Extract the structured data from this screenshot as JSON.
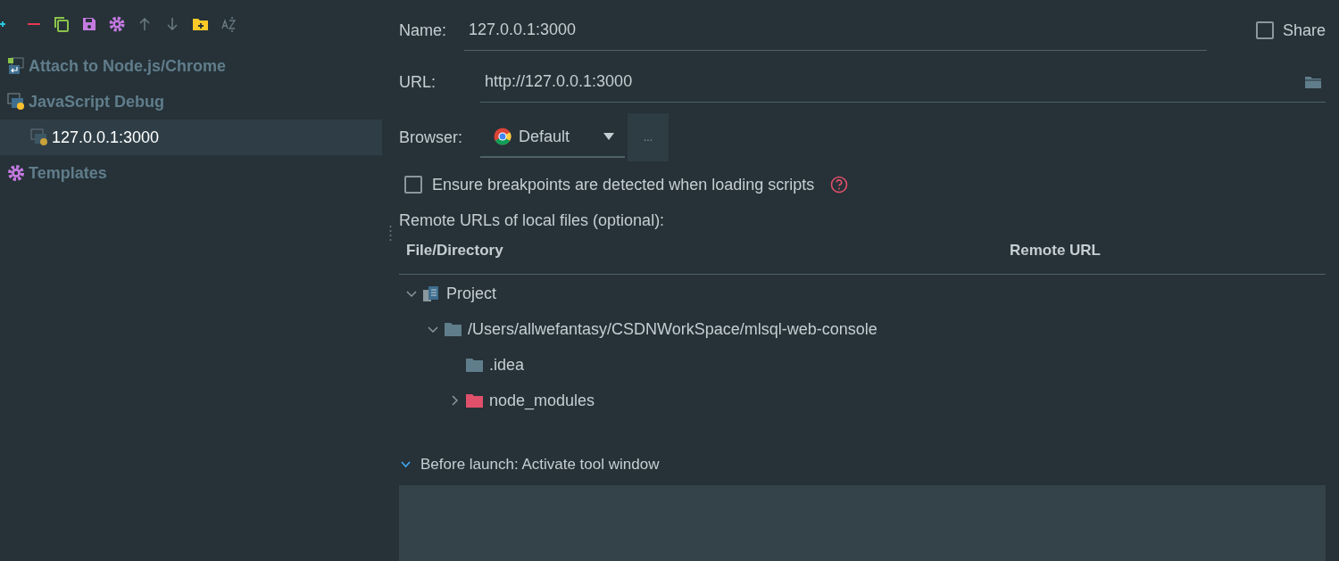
{
  "toolbar": [
    {
      "kind": "add"
    },
    {
      "kind": "remove"
    },
    {
      "kind": "copy"
    },
    {
      "kind": "save"
    },
    {
      "kind": "settings"
    },
    {
      "kind": "up"
    },
    {
      "kind": "down"
    },
    {
      "kind": "folder"
    },
    {
      "kind": "sort"
    }
  ],
  "sidebar": {
    "items": [
      {
        "label": "Attach to Node.js/Chrome",
        "kind": "attach",
        "selected": false
      },
      {
        "label": "JavaScript Debug",
        "kind": "debug",
        "selected": false,
        "expanded": true,
        "children": [
          {
            "label": "127.0.0.1:3000",
            "kind": "config",
            "selected": true
          }
        ]
      },
      {
        "label": "Templates",
        "kind": "templates",
        "selected": false
      }
    ]
  },
  "form": {
    "name": {
      "label": "Name:",
      "value": "127.0.0.1:3000"
    },
    "share": {
      "label": "Share",
      "checked": false
    },
    "url": {
      "label": "URL:",
      "value": "http://127.0.0.1:3000"
    },
    "browser": {
      "label": "Browser:",
      "value": "Default",
      "more": "..."
    },
    "ensure_breakpoints": {
      "label": "Ensure breakpoints are detected when loading scripts",
      "checked": false
    },
    "remote_label": "Remote URLs of local files (optional):"
  },
  "table": {
    "columns": [
      "File/Directory",
      "Remote URL"
    ],
    "rows": [
      {
        "label": "Project",
        "kind": "project",
        "expanded": true,
        "children": [
          {
            "label": "/Users/allwefantasy/CSDNWorkSpace/mlsql-web-console",
            "kind": "folder",
            "expanded": true,
            "children": [
              {
                "label": ".idea",
                "kind": "folder"
              },
              {
                "label": "node_modules",
                "kind": "excluded",
                "expanded": false
              }
            ]
          }
        ]
      }
    ]
  },
  "before_launch": {
    "label": "Before launch: Activate tool window",
    "expanded": true
  }
}
